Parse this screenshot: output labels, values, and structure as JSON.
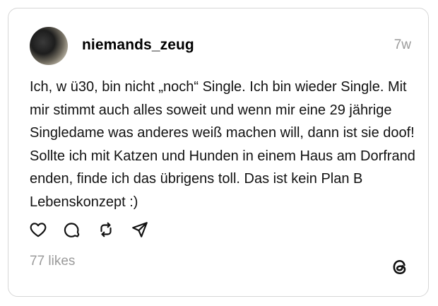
{
  "post": {
    "username": "niemands_zeug",
    "time": "7w",
    "text": "Ich, w ü30, bin nicht „noch“ Single. Ich bin wieder Single. Mit mir stimmt auch alles soweit und wenn mir eine 29 jährige Singledame was anderes weiß machen will, dann ist sie doof! Sollte ich mit Katzen und Hunden in einem Haus am Dorfrand enden, finde ich das übrigens toll. Das ist kein Plan B Lebenskonzept :)",
    "likes": "77 likes"
  },
  "icons": {
    "like": "heart-icon",
    "reply": "comment-icon",
    "repost": "repost-icon",
    "share": "send-icon",
    "brand": "threads-logo"
  },
  "colors": {
    "border": "#d6d6d6",
    "muted": "#9a9a9a",
    "text": "#111111"
  }
}
